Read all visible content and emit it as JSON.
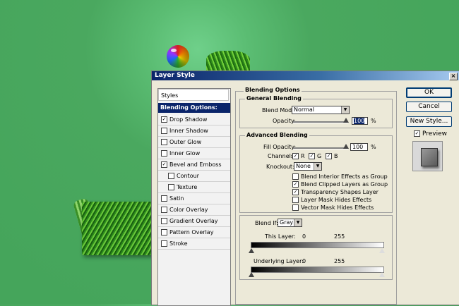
{
  "dialog": {
    "title": "Layer Style",
    "close": "×"
  },
  "styles_panel": {
    "header": "Styles",
    "selected": "Blending Options: Default",
    "items": [
      {
        "label": "Drop Shadow",
        "checked": true,
        "sub": false
      },
      {
        "label": "Inner Shadow",
        "checked": false,
        "sub": false
      },
      {
        "label": "Outer Glow",
        "checked": false,
        "sub": false
      },
      {
        "label": "Inner Glow",
        "checked": false,
        "sub": false
      },
      {
        "label": "Bevel and Emboss",
        "checked": true,
        "sub": false
      },
      {
        "label": "Contour",
        "checked": false,
        "sub": true
      },
      {
        "label": "Texture",
        "checked": false,
        "sub": true
      },
      {
        "label": "Satin",
        "checked": false,
        "sub": false
      },
      {
        "label": "Color Overlay",
        "checked": false,
        "sub": false
      },
      {
        "label": "Gradient Overlay",
        "checked": false,
        "sub": false
      },
      {
        "label": "Pattern Overlay",
        "checked": false,
        "sub": false
      },
      {
        "label": "Stroke",
        "checked": false,
        "sub": false
      }
    ]
  },
  "blending": {
    "title": "Blending Options",
    "general": {
      "title": "General Blending",
      "blend_mode_label": "Blend Mode:",
      "blend_mode_value": "Normal",
      "opacity_label": "Opacity:",
      "opacity_value": "100",
      "opacity_unit": "%"
    },
    "advanced": {
      "title": "Advanced Blending",
      "fill_opacity_label": "Fill Opacity:",
      "fill_opacity_value": "100",
      "fill_opacity_unit": "%",
      "channels_label": "Channels:",
      "channels": [
        {
          "label": "R",
          "checked": true
        },
        {
          "label": "G",
          "checked": true
        },
        {
          "label": "B",
          "checked": true
        }
      ],
      "knockout_label": "Knockout:",
      "knockout_value": "None",
      "options": [
        {
          "label": "Blend Interior Effects as Group",
          "checked": false
        },
        {
          "label": "Blend Clipped Layers as Group",
          "checked": true
        },
        {
          "label": "Transparency Shapes Layer",
          "checked": true
        },
        {
          "label": "Layer Mask Hides Effects",
          "checked": false
        },
        {
          "label": "Vector Mask Hides Effects",
          "checked": false
        }
      ]
    },
    "blend_if": {
      "label": "Blend If:",
      "value": "Gray",
      "this_layer_label": "This Layer:",
      "this_layer_min": "0",
      "this_layer_max": "255",
      "underlying_label": "Underlying Layer:",
      "underlying_min": "0",
      "underlying_max": "255"
    }
  },
  "buttons": {
    "ok": "OK",
    "cancel": "Cancel",
    "new_style": "New Style...",
    "preview_label": "Preview",
    "preview_checked": true
  },
  "check_glyph": "✓",
  "arrow_glyph": "▼"
}
